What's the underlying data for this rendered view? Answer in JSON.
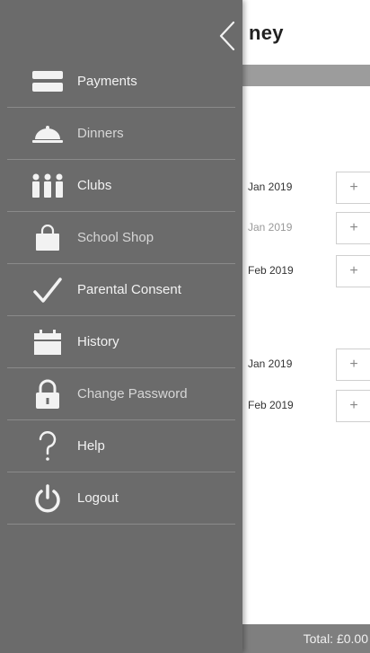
{
  "app": {
    "title": "ney",
    "rows": [
      {
        "date": "Jan 2019",
        "faded": false,
        "add": "+"
      },
      {
        "date": "Jan 2019",
        "faded": true,
        "add": "+"
      },
      {
        "date": "Feb 2019",
        "faded": false,
        "add": "+"
      },
      {
        "date": "Jan 2019",
        "faded": false,
        "add": "+"
      },
      {
        "date": "Feb 2019",
        "faded": false,
        "add": "+"
      }
    ],
    "total": "Total: £0.00"
  },
  "drawer": {
    "back_icon": "chevron-left-icon",
    "items": [
      {
        "label": "Payments",
        "icon": "card-icon"
      },
      {
        "label": "Dinners",
        "icon": "cloche-icon"
      },
      {
        "label": "Clubs",
        "icon": "people-icon"
      },
      {
        "label": "School Shop",
        "icon": "shopping-bag-icon"
      },
      {
        "label": "Parental Consent",
        "icon": "checkmark-icon"
      },
      {
        "label": "History",
        "icon": "calendar-icon"
      },
      {
        "label": "Change Password",
        "icon": "lock-icon"
      },
      {
        "label": "Help",
        "icon": "question-icon"
      },
      {
        "label": "Logout",
        "icon": "power-icon"
      }
    ]
  },
  "colors": {
    "drawer_bg": "#6b6b6b",
    "drawer_text": "#f2f2f2",
    "footer_bg": "#7f7f7f"
  }
}
